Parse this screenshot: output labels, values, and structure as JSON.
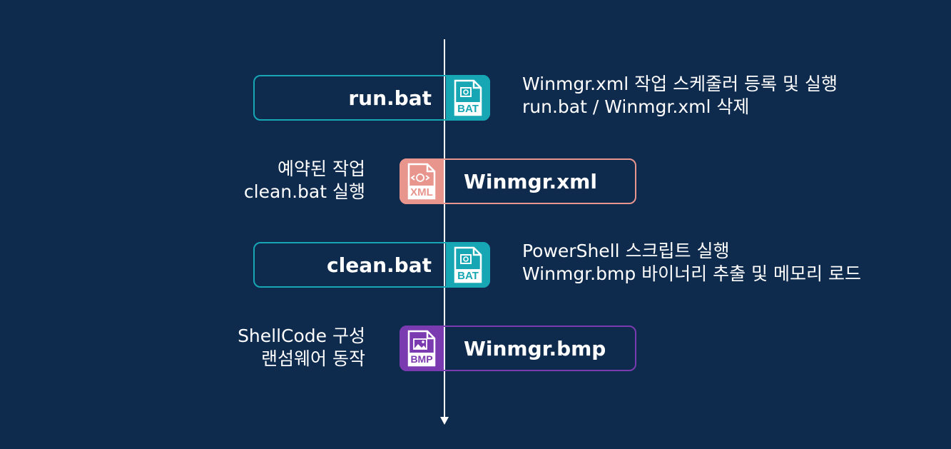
{
  "colors": {
    "background": "#0e2a4d",
    "bat": "#17a7b4",
    "xml": "#e8958e",
    "bmp": "#7b3bb0",
    "timeline": "#ffffff"
  },
  "steps": [
    {
      "file": "run.bat",
      "icon_name": "bat-file-icon",
      "icon_text": "BAT",
      "desc": [
        "Winmgr.xml 작업 스케줄러 등록 및 실행",
        "run.bat / Winmgr.xml 삭제"
      ]
    },
    {
      "file": "Winmgr.xml",
      "icon_name": "xml-file-icon",
      "icon_text": "XML",
      "desc": [
        "예약된 작업",
        "clean.bat 실행"
      ]
    },
    {
      "file": "clean.bat",
      "icon_name": "bat-file-icon",
      "icon_text": "BAT",
      "desc": [
        "PowerShell 스크립트 실행",
        "Winmgr.bmp 바이너리 추출 및 메모리 로드"
      ]
    },
    {
      "file": "Winmgr.bmp",
      "icon_name": "bmp-file-icon",
      "icon_text": "BMP",
      "desc": [
        "ShellCode 구성",
        "랜섬웨어 동작"
      ]
    }
  ]
}
